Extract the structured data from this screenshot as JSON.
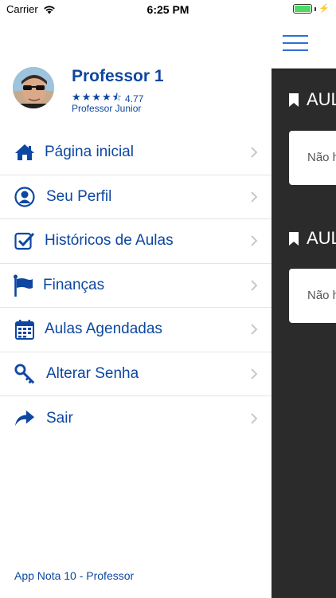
{
  "status_bar": {
    "carrier": "Carrier",
    "time": "6:25 PM"
  },
  "profile": {
    "name": "Professor 1",
    "stars": "★★★★⯪",
    "rating": "4.77",
    "level": "Professor Junior"
  },
  "menu": {
    "items": [
      {
        "label": "Página inicial",
        "icon": "home-icon"
      },
      {
        "label": "Seu Perfil",
        "icon": "user-icon"
      },
      {
        "label": "Históricos de Aulas",
        "icon": "check-square-icon"
      },
      {
        "label": "Finanças",
        "icon": "flag-icon"
      },
      {
        "label": "Aulas Agendadas",
        "icon": "calendar-icon"
      },
      {
        "label": "Alterar Senha",
        "icon": "key-icon"
      },
      {
        "label": "Sair",
        "icon": "share-arrow-icon"
      }
    ]
  },
  "footer": {
    "app_label": "App Nota 10 - Professor"
  },
  "background_content": {
    "section_1_title": "AUL",
    "section_1_card": "Não h",
    "section_2_title": "AUL",
    "section_2_card": "Não h"
  },
  "colors": {
    "primary": "#0d47a1",
    "accent": "#2e6fd8",
    "background_dark": "#2b2b2b"
  }
}
